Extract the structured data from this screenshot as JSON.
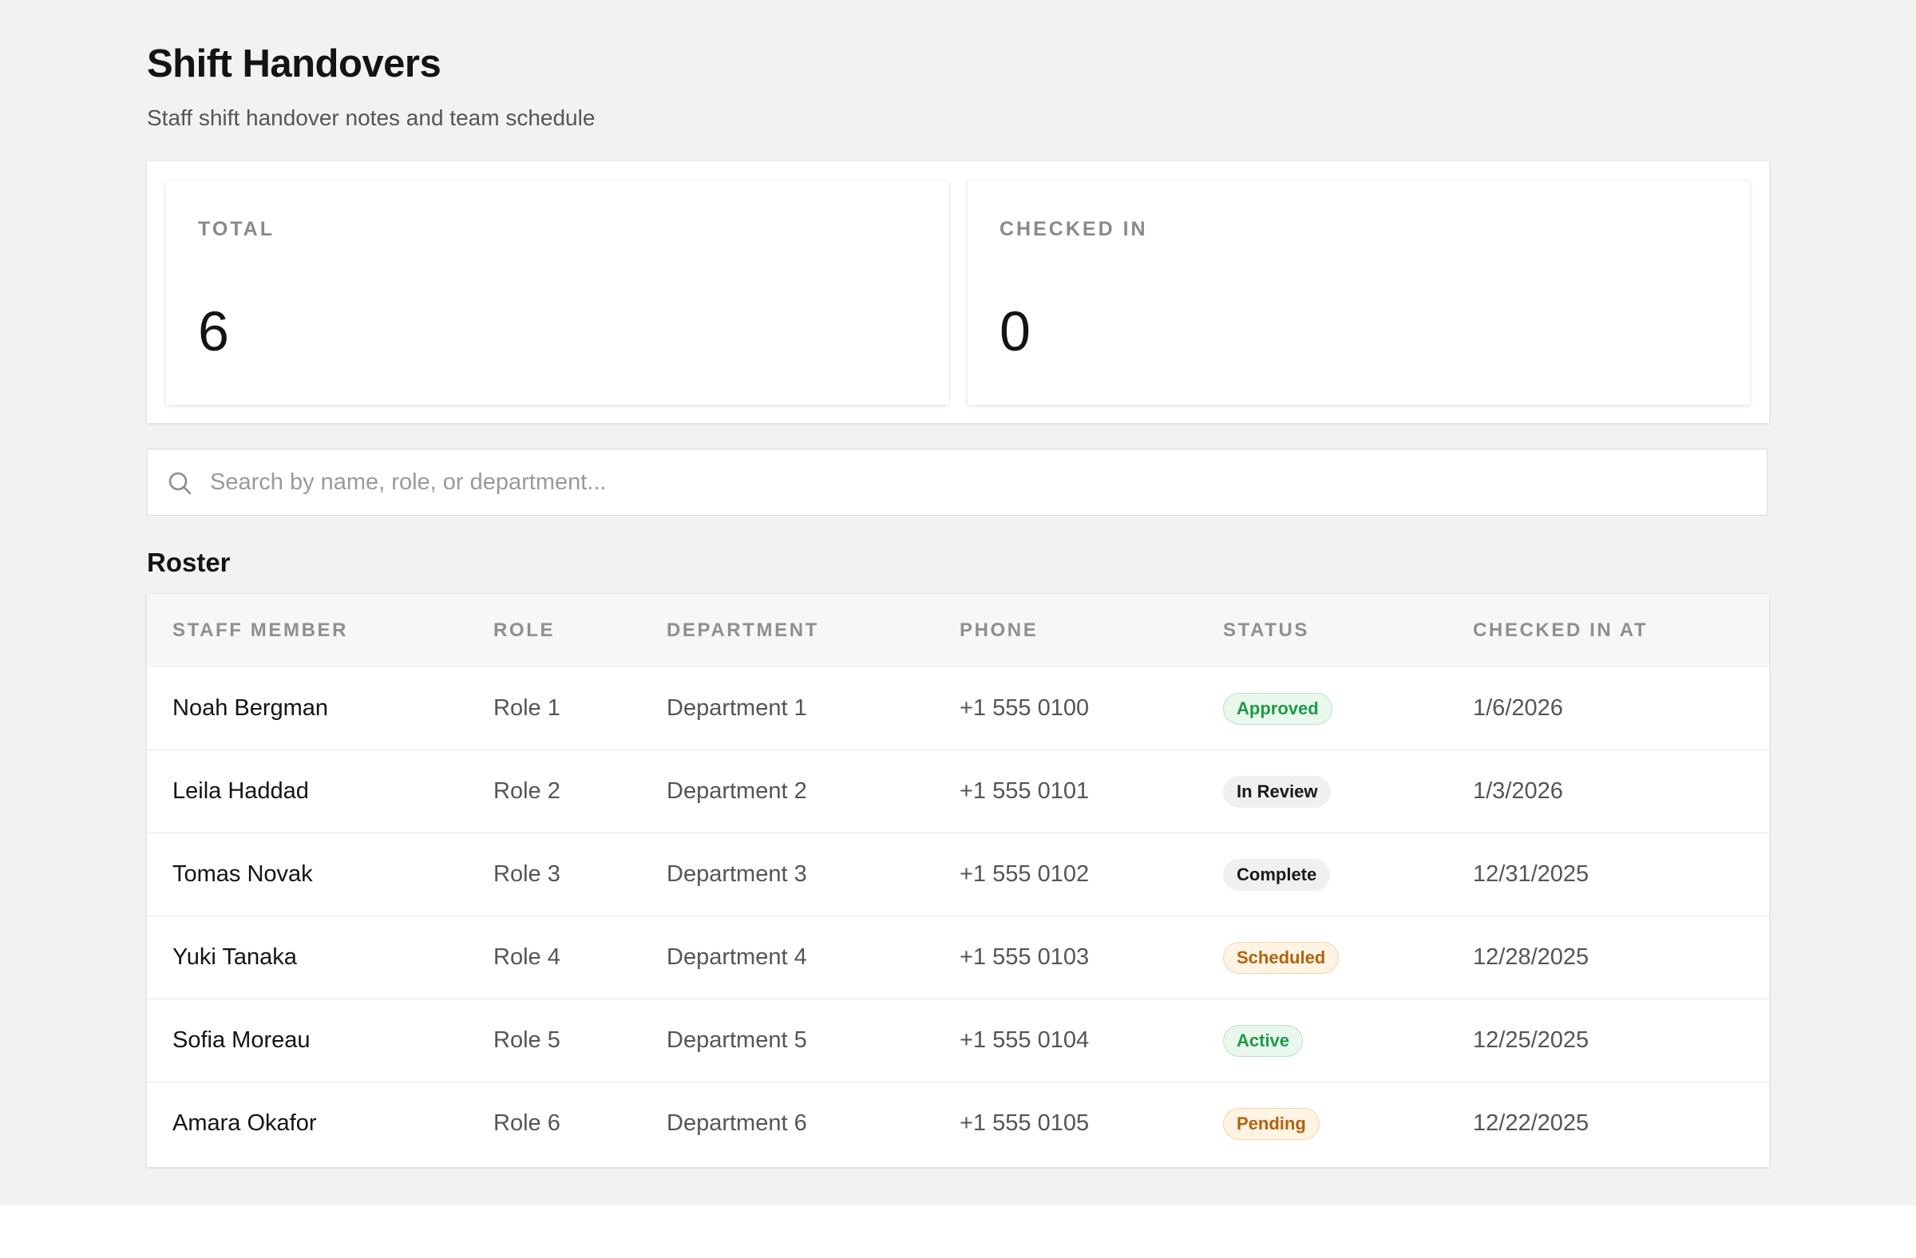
{
  "header": {
    "title": "Shift Handovers",
    "subtitle": "Staff shift handover notes and team schedule"
  },
  "stats": [
    {
      "label": "TOTAL",
      "value": "6"
    },
    {
      "label": "CHECKED IN",
      "value": "0"
    }
  ],
  "search": {
    "placeholder": "Search by name, role, or department...",
    "value": "",
    "icon": "search-icon"
  },
  "roster": {
    "title": "Roster",
    "columns": [
      "STAFF MEMBER",
      "ROLE",
      "DEPARTMENT",
      "PHONE",
      "STATUS",
      "CHECKED IN AT"
    ],
    "rows": [
      {
        "name": "Noah Bergman",
        "role": "Role 1",
        "department": "Department 1",
        "phone": "+1 555 0100",
        "status": "Approved",
        "status_tone": "green",
        "checked_in_at": "1/6/2026"
      },
      {
        "name": "Leila Haddad",
        "role": "Role 2",
        "department": "Department 2",
        "phone": "+1 555 0101",
        "status": "In Review",
        "status_tone": "gray",
        "checked_in_at": "1/3/2026"
      },
      {
        "name": "Tomas Novak",
        "role": "Role 3",
        "department": "Department 3",
        "phone": "+1 555 0102",
        "status": "Complete",
        "status_tone": "gray",
        "checked_in_at": "12/31/2025"
      },
      {
        "name": "Yuki Tanaka",
        "role": "Role 4",
        "department": "Department 4",
        "phone": "+1 555 0103",
        "status": "Scheduled",
        "status_tone": "amber",
        "checked_in_at": "12/28/2025"
      },
      {
        "name": "Sofia Moreau",
        "role": "Role 5",
        "department": "Department 5",
        "phone": "+1 555 0104",
        "status": "Active",
        "status_tone": "green",
        "checked_in_at": "12/25/2025"
      },
      {
        "name": "Amara Okafor",
        "role": "Role 6",
        "department": "Department 6",
        "phone": "+1 555 0105",
        "status": "Pending",
        "status_tone": "amber",
        "checked_in_at": "12/22/2025"
      }
    ]
  },
  "colors": {
    "page_background": "#f2f2f2",
    "status_green": "#1e9a47",
    "status_amber": "#b3620d",
    "status_gray": "#1a1a1a"
  }
}
